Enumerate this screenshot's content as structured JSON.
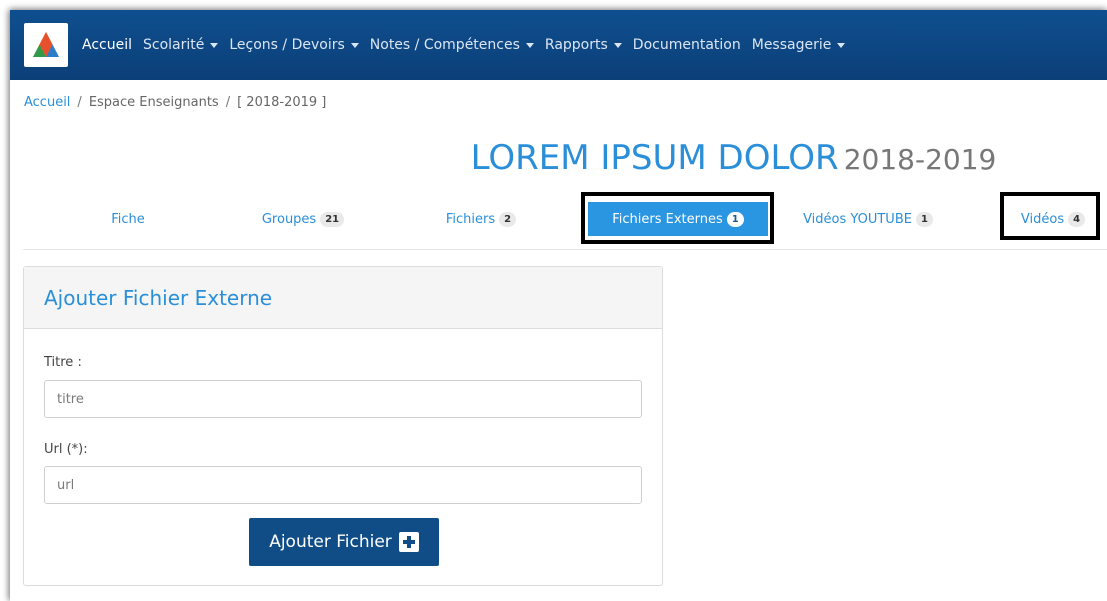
{
  "nav": {
    "items": [
      {
        "label": "Accueil",
        "caret": false,
        "active": true
      },
      {
        "label": "Scolarité",
        "caret": true,
        "active": false
      },
      {
        "label": "Leçons / Devoirs",
        "caret": true,
        "active": false
      },
      {
        "label": "Notes / Compétences",
        "caret": true,
        "active": false
      },
      {
        "label": "Rapports",
        "caret": true,
        "active": false
      },
      {
        "label": "Documentation",
        "caret": false,
        "active": false
      },
      {
        "label": "Messagerie",
        "caret": true,
        "active": false
      }
    ]
  },
  "breadcrumb": {
    "home": "Accueil",
    "separator": "/",
    "section": "Espace Enseignants",
    "year": "[ 2018-2019 ]"
  },
  "title": {
    "main": "LOREM IPSUM DOLOR",
    "year": "2018-2019"
  },
  "tabs": [
    {
      "label": "Fiche",
      "badge": null,
      "active": false
    },
    {
      "label": "Groupes",
      "badge": "21",
      "active": false
    },
    {
      "label": "Fichiers",
      "badge": "2",
      "active": false
    },
    {
      "label": "Fichiers Externes",
      "badge": "1",
      "active": true
    },
    {
      "label": "Vidéos YOUTUBE",
      "badge": "1",
      "active": false
    },
    {
      "label": "Vidéos",
      "badge": "4",
      "active": false
    }
  ],
  "form": {
    "heading": "Ajouter Fichier Externe",
    "title_label": "Titre :",
    "title_placeholder": "titre",
    "url_label": "Url (*):",
    "url_placeholder": "url",
    "submit_label": "Ajouter Fichier"
  },
  "colors": {
    "navbar": "#0b3f78",
    "accent": "#2a8fd8",
    "active_tab": "#2a95e0",
    "button": "#104d86"
  }
}
